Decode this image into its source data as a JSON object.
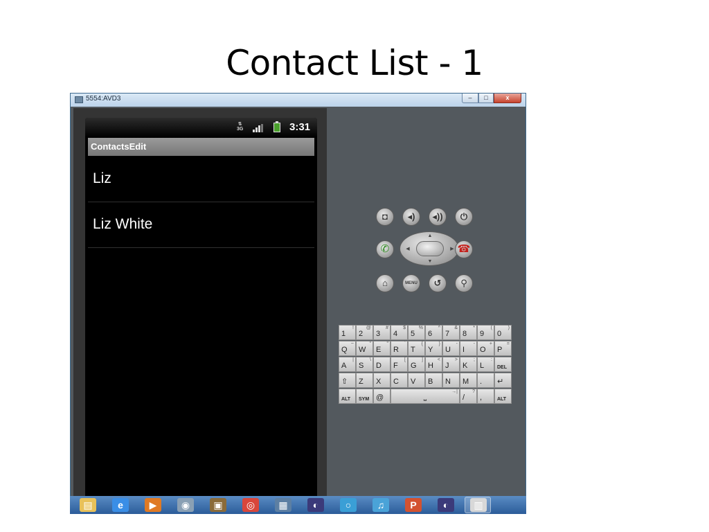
{
  "slide": {
    "title": "Contact List - 1"
  },
  "window": {
    "title": "5554:AVD3",
    "minimize": "–",
    "maximize": "□",
    "close": "x"
  },
  "status_bar": {
    "network": "3G",
    "time": "3:31"
  },
  "app": {
    "title": "ContactsEdit"
  },
  "contacts": [
    {
      "name": "Liz"
    },
    {
      "name": "Liz White"
    }
  ],
  "controls": {
    "menu_label": "MENU"
  },
  "keyboard": {
    "rows": [
      [
        {
          "main": "1",
          "alt": "!"
        },
        {
          "main": "2",
          "alt": "@"
        },
        {
          "main": "3",
          "alt": "#"
        },
        {
          "main": "4",
          "alt": "$"
        },
        {
          "main": "5",
          "alt": "%"
        },
        {
          "main": "6",
          "alt": "^"
        },
        {
          "main": "7",
          "alt": "&"
        },
        {
          "main": "8",
          "alt": "*"
        },
        {
          "main": "9",
          "alt": "("
        },
        {
          "main": "0",
          "alt": ")"
        }
      ],
      [
        {
          "main": "Q",
          "alt": "~"
        },
        {
          "main": "W",
          "alt": "\""
        },
        {
          "main": "E",
          "alt": "\""
        },
        {
          "main": "R",
          "alt": "`"
        },
        {
          "main": "T",
          "alt": "{"
        },
        {
          "main": "Y",
          "alt": "}"
        },
        {
          "main": "U",
          "alt": "-"
        },
        {
          "main": "I",
          "alt": "-"
        },
        {
          "main": "O",
          "alt": "+"
        },
        {
          "main": "P",
          "alt": "="
        }
      ],
      [
        {
          "main": "A",
          "alt": "|"
        },
        {
          "main": "S",
          "alt": "\\"
        },
        {
          "main": "D",
          "alt": ""
        },
        {
          "main": "F",
          "alt": "["
        },
        {
          "main": "G",
          "alt": "]"
        },
        {
          "main": "H",
          "alt": "<"
        },
        {
          "main": "J",
          "alt": ">"
        },
        {
          "main": "K",
          "alt": ";"
        },
        {
          "main": "L",
          "alt": ":"
        },
        {
          "main": "DEL",
          "alt": ""
        }
      ],
      [
        {
          "main": "⇧",
          "alt": ""
        },
        {
          "main": "Z",
          "alt": ""
        },
        {
          "main": "X",
          "alt": ""
        },
        {
          "main": "C",
          "alt": ""
        },
        {
          "main": "V",
          "alt": ""
        },
        {
          "main": "B",
          "alt": ""
        },
        {
          "main": "N",
          "alt": ""
        },
        {
          "main": "M",
          "alt": ""
        },
        {
          "main": ".",
          "alt": ""
        },
        {
          "main": "↵",
          "alt": ""
        }
      ]
    ],
    "bottom_row": [
      {
        "main": "ALT",
        "alt": ""
      },
      {
        "main": "SYM",
        "alt": ""
      },
      {
        "main": "@",
        "alt": ""
      },
      {
        "main": "⎵",
        "alt": "→|"
      },
      {
        "main": "/",
        "alt": "?"
      },
      {
        "main": ",",
        "alt": ""
      },
      {
        "main": "ALT",
        "alt": ""
      }
    ]
  },
  "taskbar": {
    "icons": [
      {
        "name": "folder-icon",
        "color": "#e8c15a"
      },
      {
        "name": "ie-icon",
        "color": "#3a8ee6"
      },
      {
        "name": "media-player-icon",
        "color": "#e07a24"
      },
      {
        "name": "emulator-icon",
        "color": "#8aa0b4"
      },
      {
        "name": "window-icon",
        "color": "#8a6b3a"
      },
      {
        "name": "chrome-icon",
        "color": "#d9463b"
      },
      {
        "name": "calculator-icon",
        "color": "#5c7fa3"
      },
      {
        "name": "eclipse-icon",
        "color": "#3b3a7a"
      },
      {
        "name": "loop-icon",
        "color": "#3a9fd6"
      },
      {
        "name": "itunes-icon",
        "color": "#4aa3d8"
      },
      {
        "name": "powerpoint-icon",
        "color": "#d35230"
      },
      {
        "name": "eclipse-2-icon",
        "color": "#3b3a7a"
      },
      {
        "name": "notepad-icon",
        "color": "#d8d8d8"
      }
    ]
  }
}
